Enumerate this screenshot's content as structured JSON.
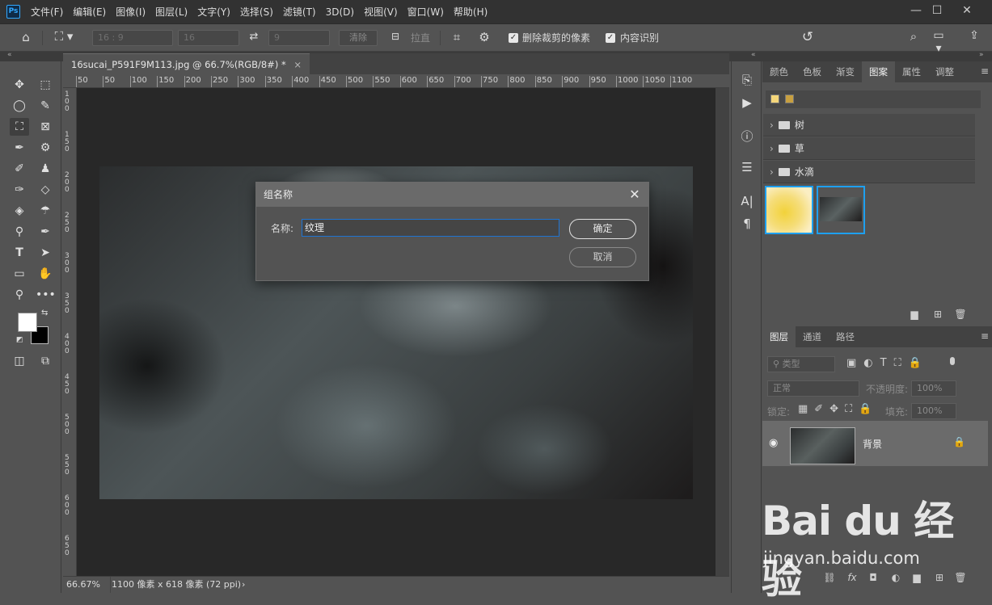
{
  "menubar": {
    "logo": "Ps",
    "items": [
      "文件(F)",
      "编辑(E)",
      "图像(I)",
      "图层(L)",
      "文字(Y)",
      "选择(S)",
      "滤镜(T)",
      "3D(D)",
      "视图(V)",
      "窗口(W)",
      "帮助(H)"
    ],
    "window_buttons": {
      "minimize": "—",
      "maximize": "☐",
      "close": "✕"
    }
  },
  "options_bar": {
    "ratio_value": "16 : 9",
    "width_value": "16",
    "height_value": "9",
    "clear_label": "清除",
    "straighten_label": "拉直",
    "delete_cropped_label": "删除裁剪的像素",
    "content_aware_label": "内容识别"
  },
  "document": {
    "tab_title": "16sucai_P591F9M113.jpg @ 66.7%(RGB/8#) *",
    "tab_close": "×",
    "ruler_h": [
      "50",
      "50",
      "100",
      "150",
      "200",
      "250",
      "300",
      "350",
      "400",
      "450",
      "500",
      "550",
      "600",
      "650",
      "700",
      "750",
      "800",
      "850",
      "900",
      "950",
      "1000",
      "1050",
      "1100"
    ],
    "ruler_v": [
      "1\n0\n0",
      "1\n5\n0",
      "2\n0\n0",
      "2\n5\n0",
      "3\n0\n0",
      "3\n5\n0",
      "4\n0\n0",
      "4\n5\n0",
      "5\n0\n0",
      "5\n5\n0",
      "6\n0\n0",
      "6\n5\n0"
    ]
  },
  "status_bar": {
    "zoom": "66.67%",
    "doc_info": "1100 像素 x 618 像素 (72 ppi)",
    "arrow": "›"
  },
  "dialog": {
    "title": "组名称",
    "name_label": "名称:",
    "name_value": "纹理",
    "ok_label": "确定",
    "cancel_label": "取消",
    "close": "✕"
  },
  "patterns_panel": {
    "tabs": [
      "颜色",
      "色板",
      "渐变",
      "图案",
      "属性",
      "调整"
    ],
    "active_tab": "图案",
    "groups": [
      "树",
      "草",
      "水滴"
    ]
  },
  "layers_panel": {
    "tabs": [
      "图层",
      "通道",
      "路径"
    ],
    "filter_placeholder": "类型",
    "blend_mode": "正常",
    "opacity_label": "不透明度:",
    "opacity_value": "100%",
    "lock_label": "锁定:",
    "fill_label": "填充:",
    "fill_value": "100%",
    "layers": [
      {
        "name": "背景"
      }
    ],
    "footer_fx": "fx"
  },
  "watermark": {
    "logo_text": "Bai du 经验",
    "url": "jingyan.baidu.com"
  },
  "colors": {
    "accent": "#1ea0f0",
    "input_border": "#1f74d2"
  }
}
